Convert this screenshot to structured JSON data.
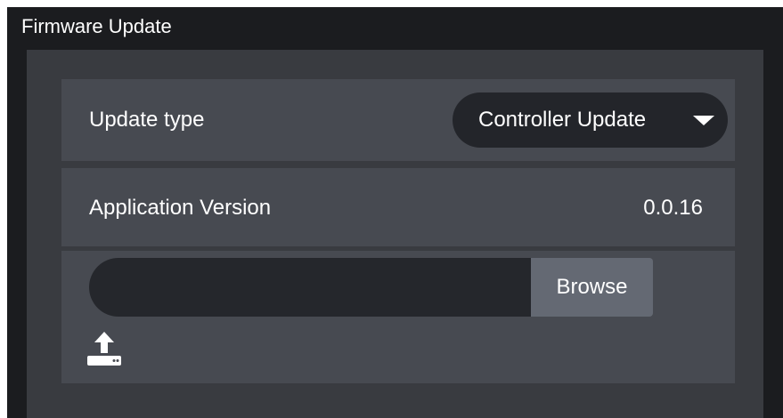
{
  "window": {
    "title": "Firmware Update"
  },
  "update_type": {
    "label": "Update type",
    "selected": "Controller Update",
    "caret_icon": "caret-down-icon"
  },
  "app_version": {
    "label": "Application Version",
    "value": "0.0.16"
  },
  "file_upload": {
    "input_value": "",
    "browse_label": "Browse",
    "upload_icon": "upload-icon"
  },
  "colors": {
    "background": "#1b1c1f",
    "panel": "#393b40",
    "row": "#474a51",
    "input": "#25272c",
    "button": "#646973",
    "text": "#ffffff"
  }
}
